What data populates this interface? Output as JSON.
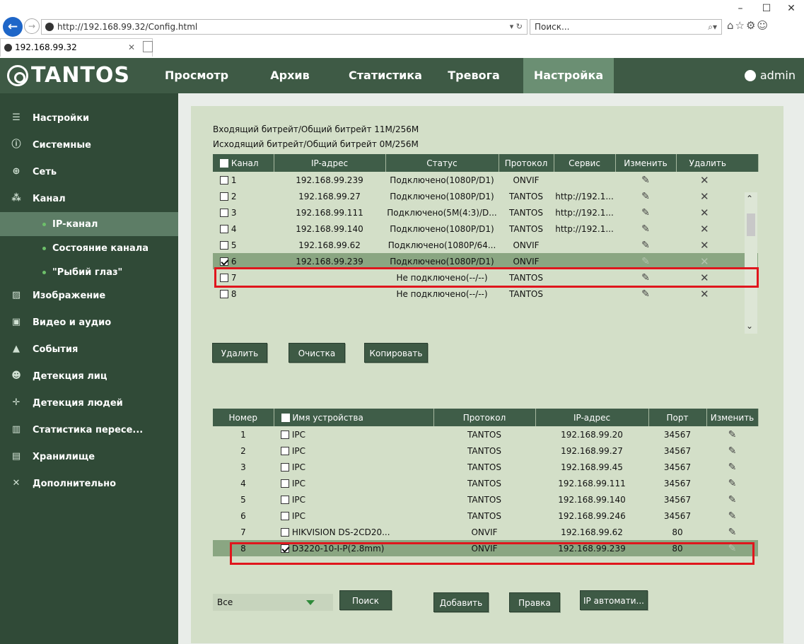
{
  "browser": {
    "url": "http://192.168.99.32/Config.html",
    "url_tools": "▾ ↻",
    "search_placeholder": "Поиск...",
    "tab_title": "192.168.99.32",
    "win_controls": [
      "–",
      "☐",
      "✕"
    ],
    "toolbar_icons": "⌂☆⚙☺"
  },
  "header": {
    "logo": "TANTOS",
    "nav": [
      "Просмотр",
      "Архив",
      "Статистика",
      "Тревога",
      "Настройка"
    ],
    "active_nav": "Настройка",
    "user": "admin"
  },
  "sidebar": {
    "items": [
      {
        "label": "Настройки",
        "icon": "settings-icon"
      },
      {
        "label": "Системные",
        "icon": "info-icon"
      },
      {
        "label": "Сеть",
        "icon": "globe-icon"
      },
      {
        "label": "Канал",
        "icon": "channel-icon"
      },
      {
        "label": "Изображение",
        "icon": "image-icon"
      },
      {
        "label": "Видео и аудио",
        "icon": "video-icon"
      },
      {
        "label": "События",
        "icon": "bell-icon"
      },
      {
        "label": "Детекция лиц",
        "icon": "face-icon"
      },
      {
        "label": "Детекция людей",
        "icon": "person-icon"
      },
      {
        "label": "Статистика пересе...",
        "icon": "stats-icon"
      },
      {
        "label": "Хранилище",
        "icon": "storage-icon"
      },
      {
        "label": "Дополнительно",
        "icon": "tools-icon"
      }
    ],
    "subitems": [
      "IP-канал",
      "Состояние канала",
      "\"Рыбий глаз\""
    ],
    "active_sub": "IP-канал"
  },
  "bitrate": {
    "incoming": "Входящий битрейт/Общий битрейт 11M/256M",
    "outgoing": "Исходящий битрейт/Общий битрейт 0M/256M"
  },
  "channels": {
    "headers": [
      "Канал",
      "IP-адрес",
      "Статус",
      "Протокол",
      "Сервис",
      "Изменить",
      "Удалить"
    ],
    "rows": [
      {
        "num": "1",
        "ip": "192.168.99.239",
        "status": "Подключено(1080P/D1)",
        "protocol": "ONVIF",
        "service": "",
        "checked": false,
        "selected": false
      },
      {
        "num": "2",
        "ip": "192.168.99.27",
        "status": "Подключено(1080P/D1)",
        "protocol": "TANTOS",
        "service": "http://192.1...",
        "checked": false,
        "selected": false
      },
      {
        "num": "3",
        "ip": "192.168.99.111",
        "status": "Подключено(5M(4:3)/D...",
        "protocol": "TANTOS",
        "service": "http://192.1...",
        "checked": false,
        "selected": false
      },
      {
        "num": "4",
        "ip": "192.168.99.140",
        "status": "Подключено(1080P/D1)",
        "protocol": "TANTOS",
        "service": "http://192.1...",
        "checked": false,
        "selected": false
      },
      {
        "num": "5",
        "ip": "192.168.99.62",
        "status": "Подключено(1080P/64...",
        "protocol": "ONVIF",
        "service": "",
        "checked": false,
        "selected": false
      },
      {
        "num": "6",
        "ip": "192.168.99.239",
        "status": "Подключено(1080P/D1)",
        "protocol": "ONVIF",
        "service": "",
        "checked": true,
        "selected": true
      },
      {
        "num": "7",
        "ip": "",
        "status": "Не подключено(--/--)",
        "protocol": "TANTOS",
        "service": "",
        "checked": false,
        "selected": false
      },
      {
        "num": "8",
        "ip": "",
        "status": "Не подключено(--/--)",
        "protocol": "TANTOS",
        "service": "",
        "checked": false,
        "selected": false
      }
    ],
    "edit_icon": "✎",
    "delete_icon": "✕"
  },
  "channel_buttons": {
    "delete": "Удалить",
    "clear": "Очистка",
    "copy": "Копировать"
  },
  "devices": {
    "headers": [
      "Номер",
      "Имя устройства",
      "Протокол",
      "IP-адрес",
      "Порт",
      "Изменить"
    ],
    "rows": [
      {
        "num": "1",
        "name": "IPC",
        "protocol": "TANTOS",
        "ip": "192.168.99.20",
        "port": "34567",
        "checked": false,
        "selected": false
      },
      {
        "num": "2",
        "name": "IPC",
        "protocol": "TANTOS",
        "ip": "192.168.99.27",
        "port": "34567",
        "checked": false,
        "selected": false
      },
      {
        "num": "3",
        "name": "IPC",
        "protocol": "TANTOS",
        "ip": "192.168.99.45",
        "port": "34567",
        "checked": false,
        "selected": false
      },
      {
        "num": "4",
        "name": "IPC",
        "protocol": "TANTOS",
        "ip": "192.168.99.111",
        "port": "34567",
        "checked": false,
        "selected": false
      },
      {
        "num": "5",
        "name": "IPC",
        "protocol": "TANTOS",
        "ip": "192.168.99.140",
        "port": "34567",
        "checked": false,
        "selected": false
      },
      {
        "num": "6",
        "name": "IPC",
        "protocol": "TANTOS",
        "ip": "192.168.99.246",
        "port": "34567",
        "checked": false,
        "selected": false
      },
      {
        "num": "7",
        "name": "HIKVISION DS-2CD20...",
        "protocol": "ONVIF",
        "ip": "192.168.99.62",
        "port": "80",
        "checked": false,
        "selected": false
      },
      {
        "num": "8",
        "name": "D3220-10-I-P(2.8mm)",
        "protocol": "ONVIF",
        "ip": "192.168.99.239",
        "port": "80",
        "checked": true,
        "selected": true
      }
    ]
  },
  "search_bar": {
    "filter_value": "Все",
    "search": "Поиск",
    "add": "Добавить",
    "edit": "Правка",
    "auto_ip": "IP автомати..."
  },
  "colors": {
    "header_bg": "#3e5a45",
    "sidebar_bg": "#304a37",
    "active_tab": "#6b8f73",
    "panel_bg": "#d3dfc8",
    "selected_row": "#8aa682",
    "highlight_box": "#e0161d"
  }
}
